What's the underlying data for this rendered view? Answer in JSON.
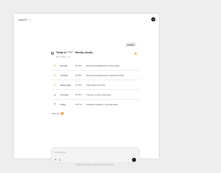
{
  "header": {
    "model_label": "ChatGPT",
    "model_chevron_icon": "chevron-down-icon",
    "avatar_icon": "user-avatar-icon"
  },
  "user_message": {
    "text": "weather"
  },
  "forecast": {
    "assistant_icon": "assistant-icon",
    "title": "Today in \"??\" · Mostly cloudy",
    "subtitle": "Next 5 days · °F",
    "current_icon": "sun-icon",
    "days": [
      {
        "day": "Monday",
        "temp": "78°/67°",
        "desc": "Morning fog followed by sunny skies",
        "icon": "sunny-icon"
      },
      {
        "day": "Tuesday",
        "temp": "76°/67°",
        "desc": "Morning fog followed by scattered clouds",
        "icon": "partly-cloudy-icon"
      },
      {
        "day": "Wednesday",
        "temp": "76°/67°",
        "desc": "Clear skies and mild",
        "icon": "sunny-icon"
      },
      {
        "day": "Thursday",
        "temp": "76°/67°",
        "desc": "Turning to more cloud later",
        "icon": "cloudy-icon"
      },
      {
        "day": "Friday",
        "temp": "78°/70°",
        "desc": "Scattered showers, overcast skies",
        "icon": "rain-icon"
      }
    ]
  },
  "sources": {
    "label": "Sources",
    "badge": "W"
  },
  "composer": {
    "placeholder": "Ask anything",
    "attach_icon": "paperclip-icon",
    "tools_icon": "globe-icon",
    "send_icon": "arrow-up-icon"
  },
  "footer": {
    "disclaimer": "ChatGPT can make mistakes. Check important info."
  }
}
